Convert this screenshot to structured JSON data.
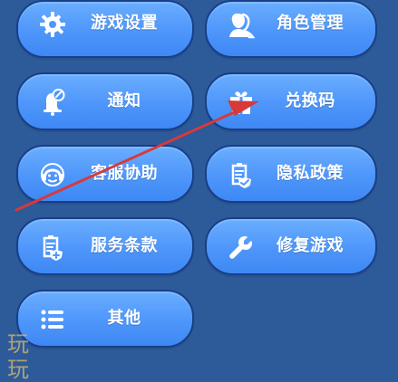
{
  "menu": {
    "items": [
      {
        "label": "游戏设置",
        "icon": "gear-icon"
      },
      {
        "label": "角色管理",
        "icon": "user-icon"
      },
      {
        "label": "通知",
        "icon": "bell-icon"
      },
      {
        "label": "兑换码",
        "icon": "gift-icon"
      },
      {
        "label": "客服协助",
        "icon": "headset-icon"
      },
      {
        "label": "隐私政策",
        "icon": "shield-document-icon"
      },
      {
        "label": "服务条款",
        "icon": "document-shield-icon"
      },
      {
        "label": "修复游戏",
        "icon": "wrench-icon"
      },
      {
        "label": "其他",
        "icon": "list-icon"
      }
    ]
  },
  "watermark": {
    "text": "玩玩"
  },
  "annotation": {
    "arrow_color": "#d63a3a"
  }
}
